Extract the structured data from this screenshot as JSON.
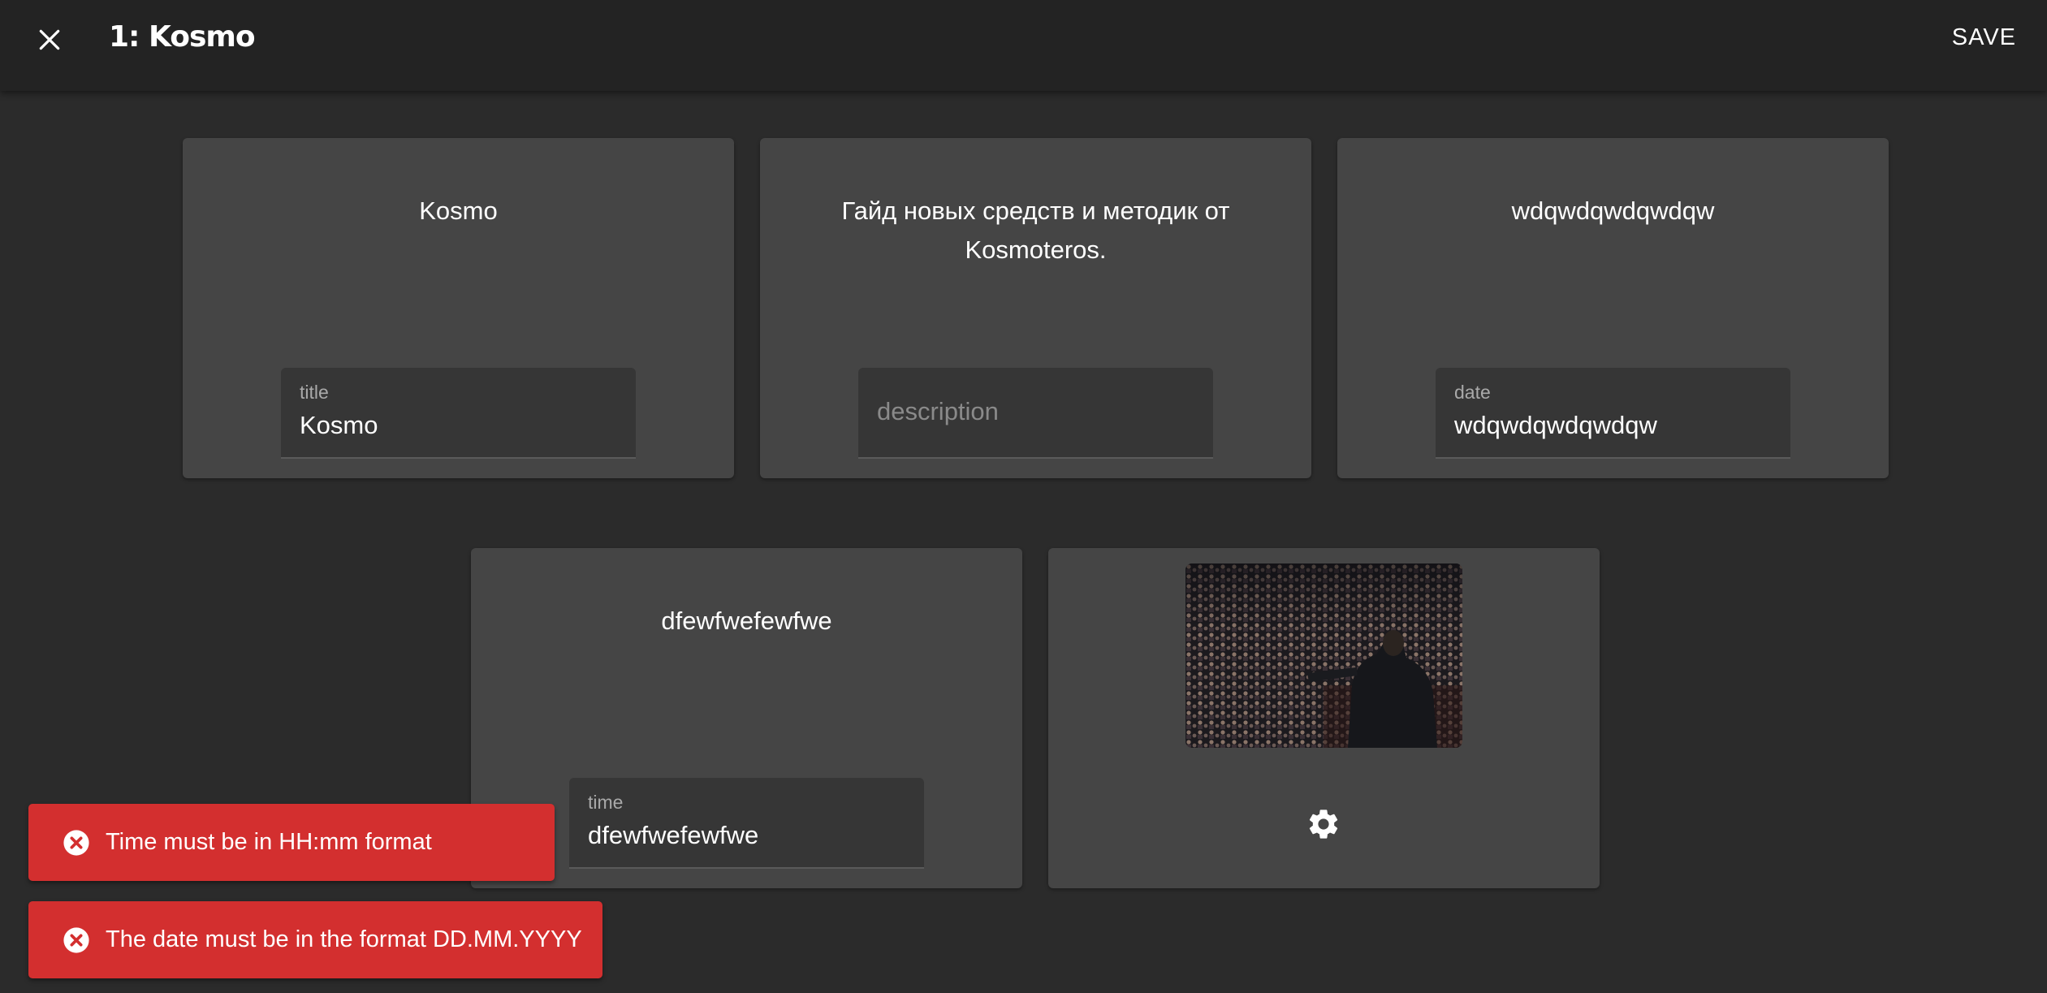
{
  "header": {
    "title": "1: Kosmo",
    "save_label": "SAVE"
  },
  "cards": {
    "title": {
      "heading": "Kosmo",
      "label": "title",
      "value": "Kosmo"
    },
    "description": {
      "heading": "Гайд новых средств и методик от Kosmoteros.",
      "placeholder": "description"
    },
    "date": {
      "heading": "wdqwdqwdqwdqw",
      "label": "date",
      "value": "wdqwdqwdqwdqw"
    },
    "time": {
      "heading": "dfewfwefewfwe",
      "label": "time",
      "value": "dfewfwefewfwe"
    }
  },
  "notifications": [
    {
      "text": "Time must be in HH:mm format"
    },
    {
      "text": "The date must be in the format DD.MM.YYYY"
    }
  ],
  "colors": {
    "background": "#2b2b2b",
    "appbar": "#232323",
    "card": "#454545",
    "field": "#363636",
    "error": "#d32f2f"
  }
}
